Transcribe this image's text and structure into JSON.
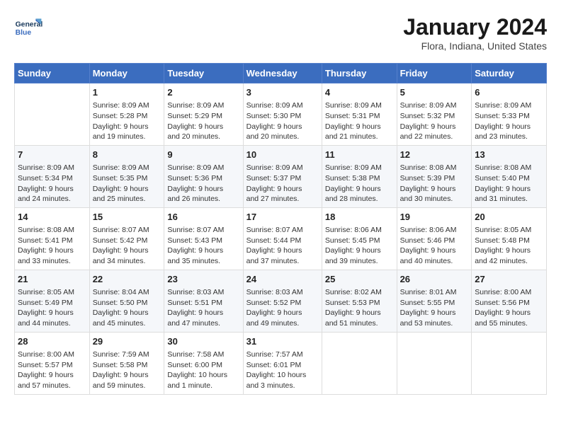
{
  "header": {
    "logo_text_general": "General",
    "logo_text_blue": "Blue",
    "title": "January 2024",
    "subtitle": "Flora, Indiana, United States"
  },
  "days_of_week": [
    "Sunday",
    "Monday",
    "Tuesday",
    "Wednesday",
    "Thursday",
    "Friday",
    "Saturday"
  ],
  "weeks": [
    [
      {
        "day": "",
        "info": ""
      },
      {
        "day": "1",
        "info": "Sunrise: 8:09 AM\nSunset: 5:28 PM\nDaylight: 9 hours\nand 19 minutes."
      },
      {
        "day": "2",
        "info": "Sunrise: 8:09 AM\nSunset: 5:29 PM\nDaylight: 9 hours\nand 20 minutes."
      },
      {
        "day": "3",
        "info": "Sunrise: 8:09 AM\nSunset: 5:30 PM\nDaylight: 9 hours\nand 20 minutes."
      },
      {
        "day": "4",
        "info": "Sunrise: 8:09 AM\nSunset: 5:31 PM\nDaylight: 9 hours\nand 21 minutes."
      },
      {
        "day": "5",
        "info": "Sunrise: 8:09 AM\nSunset: 5:32 PM\nDaylight: 9 hours\nand 22 minutes."
      },
      {
        "day": "6",
        "info": "Sunrise: 8:09 AM\nSunset: 5:33 PM\nDaylight: 9 hours\nand 23 minutes."
      }
    ],
    [
      {
        "day": "7",
        "info": "Sunrise: 8:09 AM\nSunset: 5:34 PM\nDaylight: 9 hours\nand 24 minutes."
      },
      {
        "day": "8",
        "info": "Sunrise: 8:09 AM\nSunset: 5:35 PM\nDaylight: 9 hours\nand 25 minutes."
      },
      {
        "day": "9",
        "info": "Sunrise: 8:09 AM\nSunset: 5:36 PM\nDaylight: 9 hours\nand 26 minutes."
      },
      {
        "day": "10",
        "info": "Sunrise: 8:09 AM\nSunset: 5:37 PM\nDaylight: 9 hours\nand 27 minutes."
      },
      {
        "day": "11",
        "info": "Sunrise: 8:09 AM\nSunset: 5:38 PM\nDaylight: 9 hours\nand 28 minutes."
      },
      {
        "day": "12",
        "info": "Sunrise: 8:08 AM\nSunset: 5:39 PM\nDaylight: 9 hours\nand 30 minutes."
      },
      {
        "day": "13",
        "info": "Sunrise: 8:08 AM\nSunset: 5:40 PM\nDaylight: 9 hours\nand 31 minutes."
      }
    ],
    [
      {
        "day": "14",
        "info": "Sunrise: 8:08 AM\nSunset: 5:41 PM\nDaylight: 9 hours\nand 33 minutes."
      },
      {
        "day": "15",
        "info": "Sunrise: 8:07 AM\nSunset: 5:42 PM\nDaylight: 9 hours\nand 34 minutes."
      },
      {
        "day": "16",
        "info": "Sunrise: 8:07 AM\nSunset: 5:43 PM\nDaylight: 9 hours\nand 35 minutes."
      },
      {
        "day": "17",
        "info": "Sunrise: 8:07 AM\nSunset: 5:44 PM\nDaylight: 9 hours\nand 37 minutes."
      },
      {
        "day": "18",
        "info": "Sunrise: 8:06 AM\nSunset: 5:45 PM\nDaylight: 9 hours\nand 39 minutes."
      },
      {
        "day": "19",
        "info": "Sunrise: 8:06 AM\nSunset: 5:46 PM\nDaylight: 9 hours\nand 40 minutes."
      },
      {
        "day": "20",
        "info": "Sunrise: 8:05 AM\nSunset: 5:48 PM\nDaylight: 9 hours\nand 42 minutes."
      }
    ],
    [
      {
        "day": "21",
        "info": "Sunrise: 8:05 AM\nSunset: 5:49 PM\nDaylight: 9 hours\nand 44 minutes."
      },
      {
        "day": "22",
        "info": "Sunrise: 8:04 AM\nSunset: 5:50 PM\nDaylight: 9 hours\nand 45 minutes."
      },
      {
        "day": "23",
        "info": "Sunrise: 8:03 AM\nSunset: 5:51 PM\nDaylight: 9 hours\nand 47 minutes."
      },
      {
        "day": "24",
        "info": "Sunrise: 8:03 AM\nSunset: 5:52 PM\nDaylight: 9 hours\nand 49 minutes."
      },
      {
        "day": "25",
        "info": "Sunrise: 8:02 AM\nSunset: 5:53 PM\nDaylight: 9 hours\nand 51 minutes."
      },
      {
        "day": "26",
        "info": "Sunrise: 8:01 AM\nSunset: 5:55 PM\nDaylight: 9 hours\nand 53 minutes."
      },
      {
        "day": "27",
        "info": "Sunrise: 8:00 AM\nSunset: 5:56 PM\nDaylight: 9 hours\nand 55 minutes."
      }
    ],
    [
      {
        "day": "28",
        "info": "Sunrise: 8:00 AM\nSunset: 5:57 PM\nDaylight: 9 hours\nand 57 minutes."
      },
      {
        "day": "29",
        "info": "Sunrise: 7:59 AM\nSunset: 5:58 PM\nDaylight: 9 hours\nand 59 minutes."
      },
      {
        "day": "30",
        "info": "Sunrise: 7:58 AM\nSunset: 6:00 PM\nDaylight: 10 hours\nand 1 minute."
      },
      {
        "day": "31",
        "info": "Sunrise: 7:57 AM\nSunset: 6:01 PM\nDaylight: 10 hours\nand 3 minutes."
      },
      {
        "day": "",
        "info": ""
      },
      {
        "day": "",
        "info": ""
      },
      {
        "day": "",
        "info": ""
      }
    ]
  ]
}
